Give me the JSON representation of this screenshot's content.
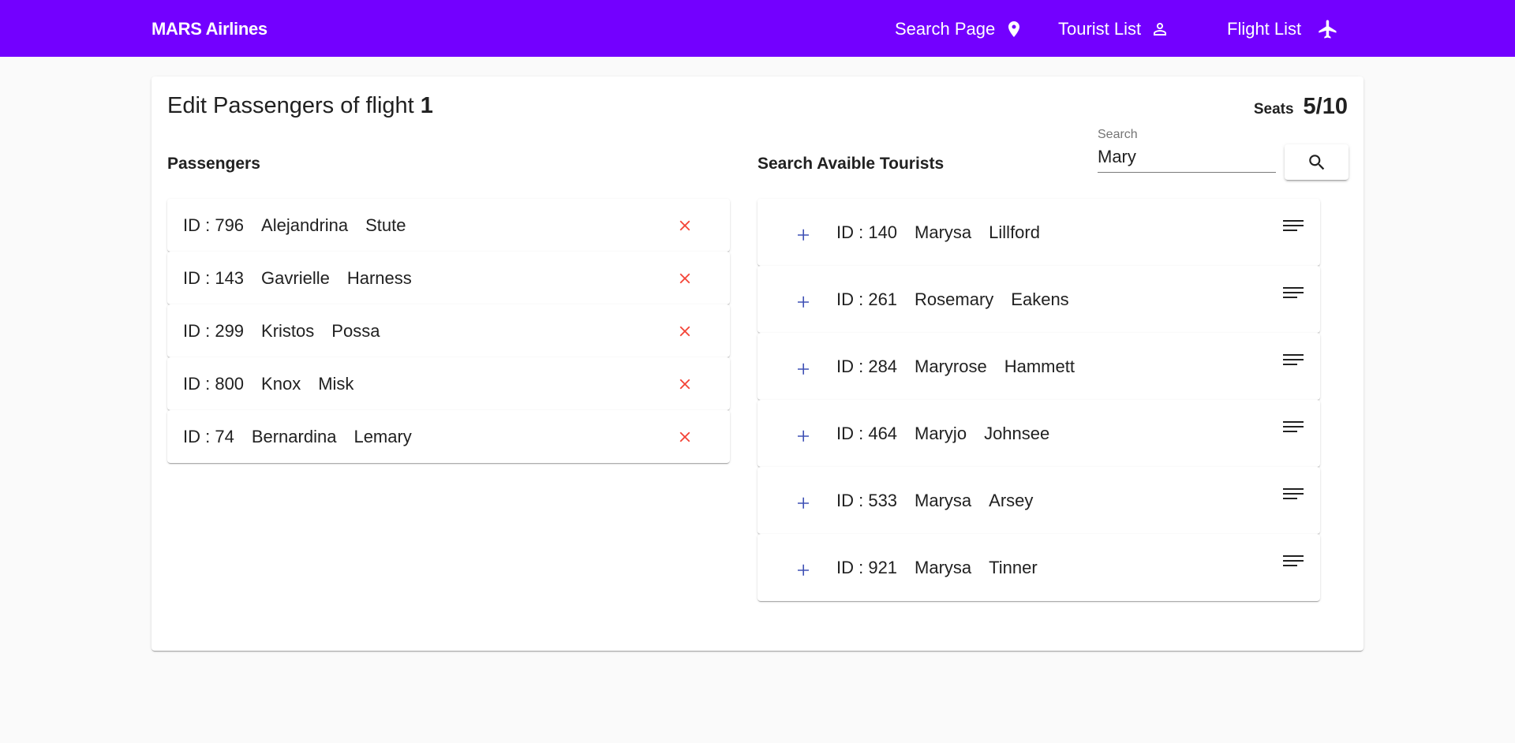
{
  "app": {
    "brand": "MARS Airlines",
    "accent_color": "#7300ff"
  },
  "nav": {
    "search_page": {
      "label": "Search Page",
      "icon": "location-pin-icon"
    },
    "tourist_list": {
      "label": "Tourist List",
      "icon": "person-icon"
    },
    "flight_list": {
      "label": "Flight List",
      "icon": "airplane-icon"
    }
  },
  "header": {
    "title_prefix": "Edit Passengers of flight",
    "flight_number": "1",
    "seats_label": "Seats",
    "seats_value": "5/10"
  },
  "passengers": {
    "title": "Passengers",
    "items": [
      {
        "id": "ID : 796",
        "first": "Alejandrina",
        "last": "Stute"
      },
      {
        "id": "ID : 143",
        "first": "Gavrielle",
        "last": "Harness"
      },
      {
        "id": "ID : 299",
        "first": "Kristos",
        "last": "Possa"
      },
      {
        "id": "ID : 800",
        "first": "Knox",
        "last": "Misk"
      },
      {
        "id": "ID : 74",
        "first": "Bernardina",
        "last": "Lemary"
      }
    ],
    "remove_icon": "close-icon",
    "remove_color": "#f44336"
  },
  "tourists": {
    "title": "Search Avaible Tourists",
    "search": {
      "label": "Search",
      "value": "Mary"
    },
    "items": [
      {
        "id": "ID : 140",
        "first": "Marysa",
        "last": "Lillford"
      },
      {
        "id": "ID : 261",
        "first": "Rosemary",
        "last": "Eakens"
      },
      {
        "id": "ID : 284",
        "first": "Maryrose",
        "last": "Hammett"
      },
      {
        "id": "ID : 464",
        "first": "Maryjo",
        "last": "Johnsee"
      },
      {
        "id": "ID : 533",
        "first": "Marysa",
        "last": "Arsey"
      },
      {
        "id": "ID : 921",
        "first": "Marysa",
        "last": "Tinner"
      }
    ],
    "add_icon": "plus-icon",
    "add_color": "#3f51b5",
    "details_icon": "menu-lines-icon"
  }
}
